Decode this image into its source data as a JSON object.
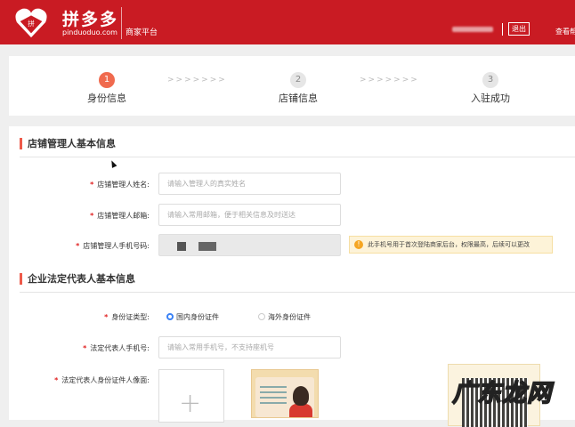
{
  "header": {
    "brand": "拼多多",
    "domain": "pinduoduo.com",
    "platform": "商家平台",
    "logout": "退出",
    "view_more": "查看帮"
  },
  "steps": [
    {
      "num": "1",
      "label": "身份信息",
      "active": true
    },
    {
      "num": "2",
      "label": "店铺信息",
      "active": false
    },
    {
      "num": "3",
      "label": "入驻成功",
      "active": false
    }
  ],
  "step_separator": ">>>>>>>",
  "section1": {
    "title": "店铺管理人基本信息",
    "name": {
      "label": "店铺管理人姓名:",
      "placeholder": "请输入管理人的真实姓名"
    },
    "email": {
      "label": "店铺管理人邮箱:",
      "placeholder": "请输入常用邮箱，便于相关信息及时送达"
    },
    "phone": {
      "label": "店铺管理人手机号码:",
      "tip": "此手机号用于首次登陆商家后台，权限最高，后续可以更改"
    }
  },
  "section2": {
    "title": "企业法定代表人基本信息",
    "id_type": {
      "label": "身份证类型:",
      "options": [
        "国内身份证件",
        "海外身份证件"
      ],
      "selected": "国内身份证件"
    },
    "phone": {
      "label": "法定代表人手机号:",
      "placeholder": "请输入常用手机号，不支持座机号"
    },
    "id_photo": {
      "label": "法定代表人身份证件人像面:"
    }
  },
  "required_mark": "*",
  "watermark": "广东龙网"
}
